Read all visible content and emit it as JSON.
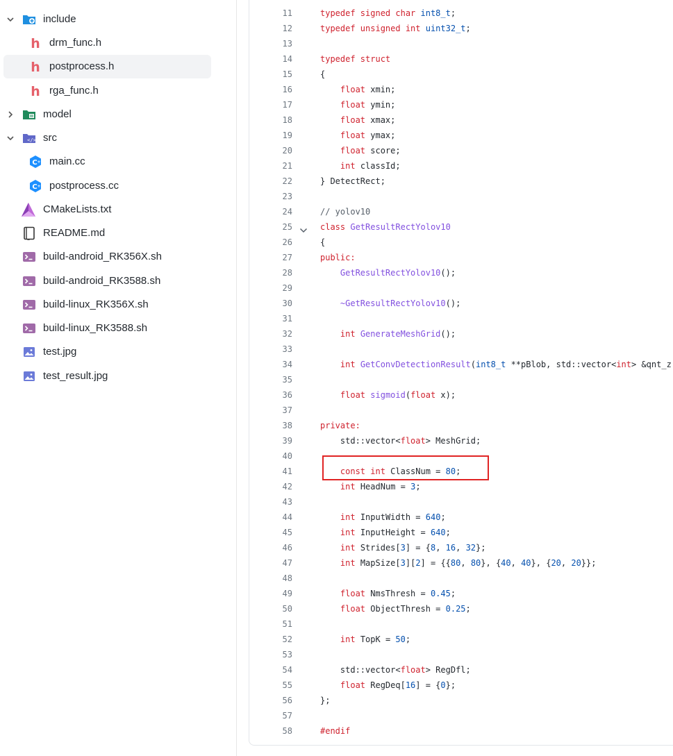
{
  "file_tree": [
    {
      "label": "include",
      "icon": "folder-include-icon",
      "depth": 0,
      "chevron": "down",
      "selected": false
    },
    {
      "label": "drm_func.h",
      "icon": "c-header-icon",
      "depth": 1,
      "selected": false
    },
    {
      "label": "postprocess.h",
      "icon": "c-header-icon",
      "depth": 1,
      "selected": true
    },
    {
      "label": "rga_func.h",
      "icon": "c-header-icon",
      "depth": 1,
      "selected": false
    },
    {
      "label": "model",
      "icon": "folder-model-icon",
      "depth": 0,
      "chevron": "right",
      "selected": false
    },
    {
      "label": "src",
      "icon": "folder-src-icon",
      "depth": 0,
      "chevron": "down",
      "selected": false
    },
    {
      "label": "main.cc",
      "icon": "cpp-file-icon",
      "depth": 1,
      "selected": false
    },
    {
      "label": "postprocess.cc",
      "icon": "cpp-file-icon",
      "depth": 1,
      "selected": false
    },
    {
      "label": "CMakeLists.txt",
      "icon": "cmake-icon",
      "depth": 0,
      "selected": false
    },
    {
      "label": "README.md",
      "icon": "readme-book-icon",
      "depth": 0,
      "selected": false
    },
    {
      "label": "build-android_RK356X.sh",
      "icon": "terminal-icon",
      "depth": 0,
      "selected": false
    },
    {
      "label": "build-android_RK3588.sh",
      "icon": "terminal-icon",
      "depth": 0,
      "selected": false
    },
    {
      "label": "build-linux_RK356X.sh",
      "icon": "terminal-icon",
      "depth": 0,
      "selected": false
    },
    {
      "label": "build-linux_RK3588.sh",
      "icon": "terminal-icon",
      "depth": 0,
      "selected": false
    },
    {
      "label": "test.jpg",
      "icon": "image-file-icon",
      "depth": 0,
      "selected": false
    },
    {
      "label": "test_result.jpg",
      "icon": "image-file-icon",
      "depth": 0,
      "selected": false
    }
  ],
  "code": {
    "highlighted_line": "41",
    "lines": [
      {
        "n": "11",
        "tokens": [
          [
            "k",
            "typedef signed char "
          ],
          [
            "t",
            "int8_t"
          ],
          [
            "p",
            ";"
          ]
        ]
      },
      {
        "n": "12",
        "tokens": [
          [
            "k",
            "typedef unsigned int "
          ],
          [
            "t",
            "uint32_t"
          ],
          [
            "p",
            ";"
          ]
        ]
      },
      {
        "n": "13",
        "tokens": []
      },
      {
        "n": "14",
        "tokens": [
          [
            "k",
            "typedef struct"
          ]
        ]
      },
      {
        "n": "15",
        "tokens": [
          [
            "p",
            "{"
          ]
        ]
      },
      {
        "n": "16",
        "tokens": [
          [
            "p",
            "    "
          ],
          [
            "k",
            "float"
          ],
          [
            "p",
            " xmin;"
          ]
        ]
      },
      {
        "n": "17",
        "tokens": [
          [
            "p",
            "    "
          ],
          [
            "k",
            "float"
          ],
          [
            "p",
            " ymin;"
          ]
        ]
      },
      {
        "n": "18",
        "tokens": [
          [
            "p",
            "    "
          ],
          [
            "k",
            "float"
          ],
          [
            "p",
            " xmax;"
          ]
        ]
      },
      {
        "n": "19",
        "tokens": [
          [
            "p",
            "    "
          ],
          [
            "k",
            "float"
          ],
          [
            "p",
            " ymax;"
          ]
        ]
      },
      {
        "n": "20",
        "tokens": [
          [
            "p",
            "    "
          ],
          [
            "k",
            "float"
          ],
          [
            "p",
            " score;"
          ]
        ]
      },
      {
        "n": "21",
        "tokens": [
          [
            "p",
            "    "
          ],
          [
            "k",
            "int"
          ],
          [
            "p",
            " classId;"
          ]
        ]
      },
      {
        "n": "22",
        "tokens": [
          [
            "p",
            "} DetectRect;"
          ]
        ]
      },
      {
        "n": "23",
        "tokens": []
      },
      {
        "n": "24",
        "tokens": [
          [
            "c",
            "// yolov10"
          ]
        ]
      },
      {
        "n": "25",
        "fold": true,
        "tokens": [
          [
            "k",
            "class "
          ],
          [
            "f",
            "GetResultRectYolov10"
          ]
        ]
      },
      {
        "n": "26",
        "tokens": [
          [
            "p",
            "{"
          ]
        ]
      },
      {
        "n": "27",
        "tokens": [
          [
            "k",
            "public:"
          ]
        ]
      },
      {
        "n": "28",
        "tokens": [
          [
            "p",
            "    "
          ],
          [
            "f",
            "GetResultRectYolov10"
          ],
          [
            "p",
            "();"
          ]
        ]
      },
      {
        "n": "29",
        "tokens": []
      },
      {
        "n": "30",
        "tokens": [
          [
            "p",
            "    "
          ],
          [
            "f",
            "~GetResultRectYolov10"
          ],
          [
            "p",
            "();"
          ]
        ]
      },
      {
        "n": "31",
        "tokens": []
      },
      {
        "n": "32",
        "tokens": [
          [
            "p",
            "    "
          ],
          [
            "k",
            "int "
          ],
          [
            "f",
            "GenerateMeshGrid"
          ],
          [
            "p",
            "();"
          ]
        ]
      },
      {
        "n": "33",
        "tokens": []
      },
      {
        "n": "34",
        "tokens": [
          [
            "p",
            "    "
          ],
          [
            "k",
            "int "
          ],
          [
            "f",
            "GetConvDetectionResult"
          ],
          [
            "p",
            "("
          ],
          [
            "t",
            "int8_t"
          ],
          [
            "p",
            " **pBlob, std::vector<"
          ],
          [
            "k",
            "int"
          ],
          [
            "p",
            "> &qnt_z"
          ]
        ]
      },
      {
        "n": "35",
        "tokens": []
      },
      {
        "n": "36",
        "tokens": [
          [
            "p",
            "    "
          ],
          [
            "k",
            "float "
          ],
          [
            "f",
            "sigmoid"
          ],
          [
            "p",
            "("
          ],
          [
            "k",
            "float"
          ],
          [
            "p",
            " x);"
          ]
        ]
      },
      {
        "n": "37",
        "tokens": []
      },
      {
        "n": "38",
        "tokens": [
          [
            "k",
            "private:"
          ]
        ]
      },
      {
        "n": "39",
        "tokens": [
          [
            "p",
            "    std::vector<"
          ],
          [
            "k",
            "float"
          ],
          [
            "p",
            "> MeshGrid;"
          ]
        ]
      },
      {
        "n": "40",
        "tokens": []
      },
      {
        "n": "41",
        "tokens": [
          [
            "p",
            "    "
          ],
          [
            "k",
            "const int"
          ],
          [
            "p",
            " ClassNum = "
          ],
          [
            "n",
            "80"
          ],
          [
            "p",
            ";"
          ]
        ]
      },
      {
        "n": "42",
        "tokens": [
          [
            "p",
            "    "
          ],
          [
            "k",
            "int"
          ],
          [
            "p",
            " HeadNum = "
          ],
          [
            "n",
            "3"
          ],
          [
            "p",
            ";"
          ]
        ]
      },
      {
        "n": "43",
        "tokens": []
      },
      {
        "n": "44",
        "tokens": [
          [
            "p",
            "    "
          ],
          [
            "k",
            "int"
          ],
          [
            "p",
            " InputWidth = "
          ],
          [
            "n",
            "640"
          ],
          [
            "p",
            ";"
          ]
        ]
      },
      {
        "n": "45",
        "tokens": [
          [
            "p",
            "    "
          ],
          [
            "k",
            "int"
          ],
          [
            "p",
            " InputHeight = "
          ],
          [
            "n",
            "640"
          ],
          [
            "p",
            ";"
          ]
        ]
      },
      {
        "n": "46",
        "tokens": [
          [
            "p",
            "    "
          ],
          [
            "k",
            "int"
          ],
          [
            "p",
            " Strides["
          ],
          [
            "n",
            "3"
          ],
          [
            "p",
            "] = {"
          ],
          [
            "n",
            "8"
          ],
          [
            "p",
            ", "
          ],
          [
            "n",
            "16"
          ],
          [
            "p",
            ", "
          ],
          [
            "n",
            "32"
          ],
          [
            "p",
            "};"
          ]
        ]
      },
      {
        "n": "47",
        "tokens": [
          [
            "p",
            "    "
          ],
          [
            "k",
            "int"
          ],
          [
            "p",
            " MapSize["
          ],
          [
            "n",
            "3"
          ],
          [
            "p",
            "]["
          ],
          [
            "n",
            "2"
          ],
          [
            "p",
            "] = {{"
          ],
          [
            "n",
            "80"
          ],
          [
            "p",
            ", "
          ],
          [
            "n",
            "80"
          ],
          [
            "p",
            "}, {"
          ],
          [
            "n",
            "40"
          ],
          [
            "p",
            ", "
          ],
          [
            "n",
            "40"
          ],
          [
            "p",
            "}, {"
          ],
          [
            "n",
            "20"
          ],
          [
            "p",
            ", "
          ],
          [
            "n",
            "20"
          ],
          [
            "p",
            "}};"
          ]
        ]
      },
      {
        "n": "48",
        "tokens": []
      },
      {
        "n": "49",
        "tokens": [
          [
            "p",
            "    "
          ],
          [
            "k",
            "float"
          ],
          [
            "p",
            " NmsThresh = "
          ],
          [
            "n",
            "0.45"
          ],
          [
            "p",
            ";"
          ]
        ]
      },
      {
        "n": "50",
        "tokens": [
          [
            "p",
            "    "
          ],
          [
            "k",
            "float"
          ],
          [
            "p",
            " ObjectThresh = "
          ],
          [
            "n",
            "0.25"
          ],
          [
            "p",
            ";"
          ]
        ]
      },
      {
        "n": "51",
        "tokens": []
      },
      {
        "n": "52",
        "tokens": [
          [
            "p",
            "    "
          ],
          [
            "k",
            "int"
          ],
          [
            "p",
            " TopK = "
          ],
          [
            "n",
            "50"
          ],
          [
            "p",
            ";"
          ]
        ]
      },
      {
        "n": "53",
        "tokens": []
      },
      {
        "n": "54",
        "tokens": [
          [
            "p",
            "    std::vector<"
          ],
          [
            "k",
            "float"
          ],
          [
            "p",
            "> RegDfl;"
          ]
        ]
      },
      {
        "n": "55",
        "tokens": [
          [
            "p",
            "    "
          ],
          [
            "k",
            "float"
          ],
          [
            "p",
            " RegDeq["
          ],
          [
            "n",
            "16"
          ],
          [
            "p",
            "] = {"
          ],
          [
            "n",
            "0"
          ],
          [
            "p",
            "};"
          ]
        ]
      },
      {
        "n": "56",
        "tokens": [
          [
            "p",
            "};"
          ]
        ]
      },
      {
        "n": "57",
        "tokens": []
      },
      {
        "n": "58",
        "tokens": [
          [
            "k",
            "#endif"
          ]
        ]
      }
    ]
  },
  "colors": {
    "keyword": "#cf222e",
    "type": "#0550ae",
    "function": "#8250df",
    "number": "#0550ae",
    "comment": "#57606a",
    "highlight_box": "#e02424"
  }
}
